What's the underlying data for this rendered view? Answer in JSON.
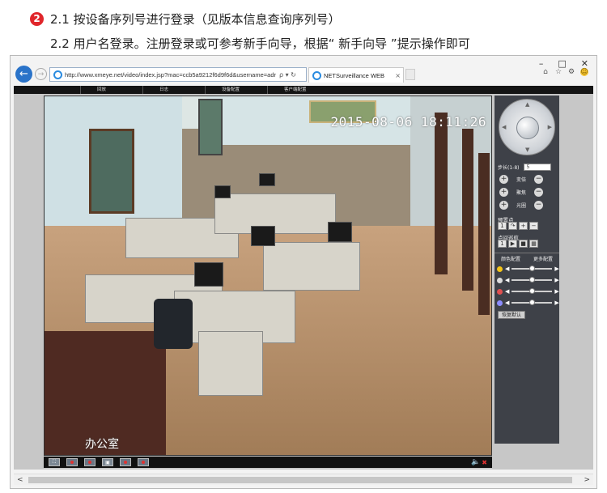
{
  "instructions": {
    "step_number": "2",
    "line1": "2.1 按设备序列号进行登录（见版本信息查询序列号）",
    "line2": "2.2 用户名登录。注册登录或可参考新手向导，根据“ 新手向导 ”提示操作即可"
  },
  "browser": {
    "window_controls": {
      "minimize": "–",
      "maximize": "□",
      "close": "✕"
    },
    "address_url": "http://www.xmeye.net/video/index.jsp?mac=ccb5a9212f6d9f6d&username=adr",
    "address_controls": "ρ ▾ ↻",
    "tab_title": "NETSurveillance WEB",
    "tab_close": "×",
    "toolbar_icons": [
      "home-icon",
      "star-icon",
      "gear-icon",
      "smiley-icon"
    ]
  },
  "app": {
    "top_menu": [
      "回放",
      "日志",
      "设备配置",
      "客户端配置"
    ],
    "video": {
      "timestamp": "2015-08-06 18:11:26",
      "caption": "办公室"
    },
    "ptz": {
      "step_label": "步长(1-8)",
      "step_value": "5",
      "zoom_label": "变倍",
      "focus_label": "聚焦",
      "iris_label": "光圈",
      "preset_label": "预置点",
      "preset_value": "1",
      "cruise_label": "点间巡航",
      "cruise_value": "1",
      "color_tab": "颜色配置",
      "more_tab": "更多配置",
      "sliders": [
        {
          "name": "brightness",
          "value": 0.5,
          "color": "#f5c518"
        },
        {
          "name": "contrast",
          "value": 0.5,
          "color": "#dddddd"
        },
        {
          "name": "saturation",
          "value": 0.5,
          "color": "#e05050"
        },
        {
          "name": "hue",
          "value": 0.5,
          "color": "#8c8cff"
        }
      ],
      "reset_label": "恢复默认"
    },
    "toolbar": {
      "buttons": [
        "fullscreen",
        "record",
        "snapshot",
        "playback",
        "talk",
        "settings"
      ]
    }
  }
}
